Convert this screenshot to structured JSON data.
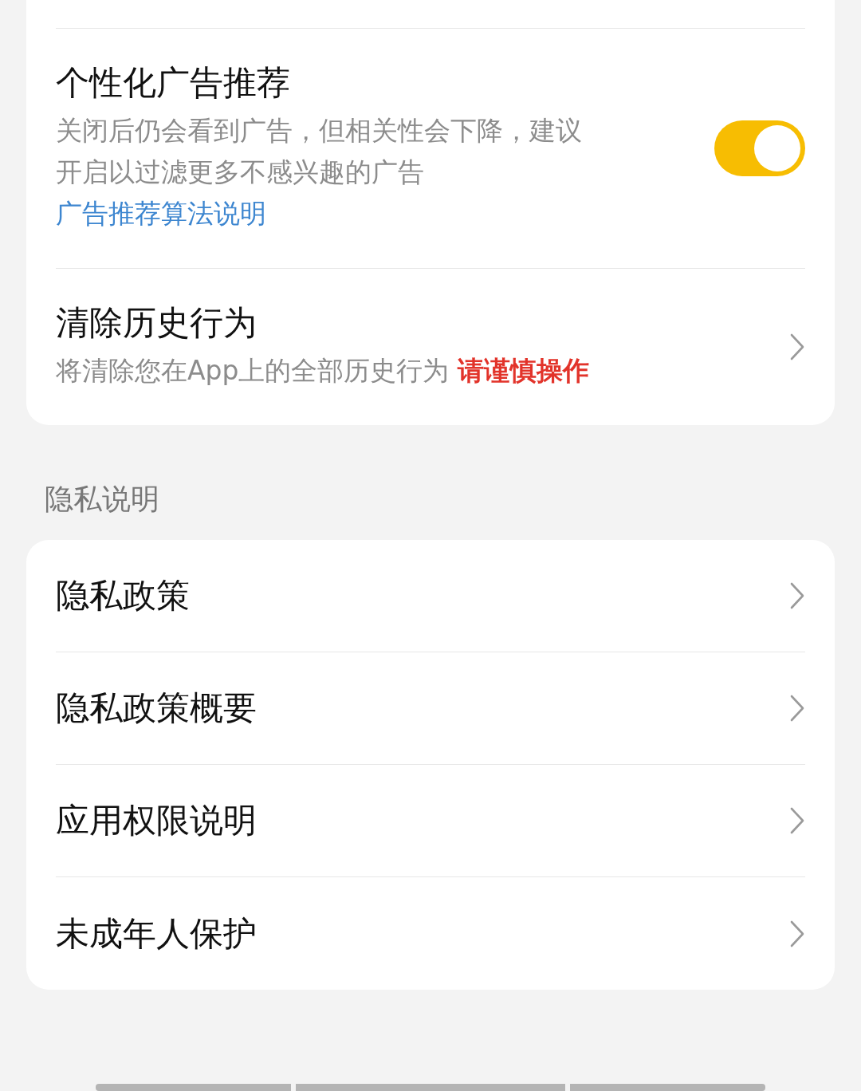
{
  "top_card": {
    "rows": [
      {
        "kind": "toggle",
        "title": "个性化广告推荐",
        "description": "关闭后仍会看到广告，但相关性会下降，建议开启以过滤更多不感兴趣的广告",
        "note": {
          "kind": "link",
          "color": "#3d86d0",
          "text": "广告推荐算法说明"
        },
        "on": true
      },
      {
        "kind": "link",
        "title": "清除历史行为",
        "description": "将清除您在App上的全部历史行为",
        "note": {
          "kind": "warning",
          "color": "#e2332a",
          "text": "请谨慎操作"
        }
      }
    ]
  },
  "section_label": "隐私说明",
  "privacy_card": {
    "rows": [
      {
        "kind": "link",
        "title": "隐私政策"
      },
      {
        "kind": "link",
        "title": "隐私政策概要"
      },
      {
        "kind": "link",
        "title": "应用权限说明"
      },
      {
        "kind": "link",
        "title": "未成年人保护"
      }
    ]
  }
}
